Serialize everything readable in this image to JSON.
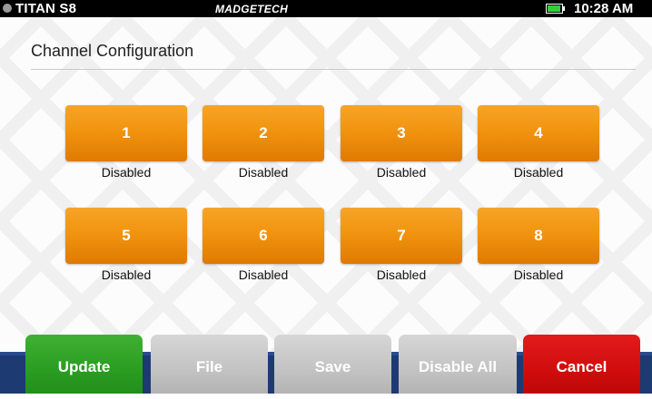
{
  "status_bar": {
    "device_name": "TITAN S8",
    "brand": "MADGETECH",
    "time": "10:28 AM",
    "battery_level": 0.9
  },
  "page": {
    "title": "Channel Configuration"
  },
  "channels": [
    {
      "label": "1",
      "status": "Disabled"
    },
    {
      "label": "2",
      "status": "Disabled"
    },
    {
      "label": "3",
      "status": "Disabled"
    },
    {
      "label": "4",
      "status": "Disabled"
    },
    {
      "label": "5",
      "status": "Disabled"
    },
    {
      "label": "6",
      "status": "Disabled"
    },
    {
      "label": "7",
      "status": "Disabled"
    },
    {
      "label": "8",
      "status": "Disabled"
    }
  ],
  "actions": {
    "update": "Update",
    "file": "File",
    "save": "Save",
    "disable_all": "Disable All",
    "cancel": "Cancel"
  },
  "colors": {
    "channel_button": "#f19410",
    "update_button": "#2a9d22",
    "cancel_button": "#d10d0d",
    "neutral_button": "#c3c3c3",
    "bottom_bar": "#1d3a72",
    "battery": "#2fcf3a"
  }
}
